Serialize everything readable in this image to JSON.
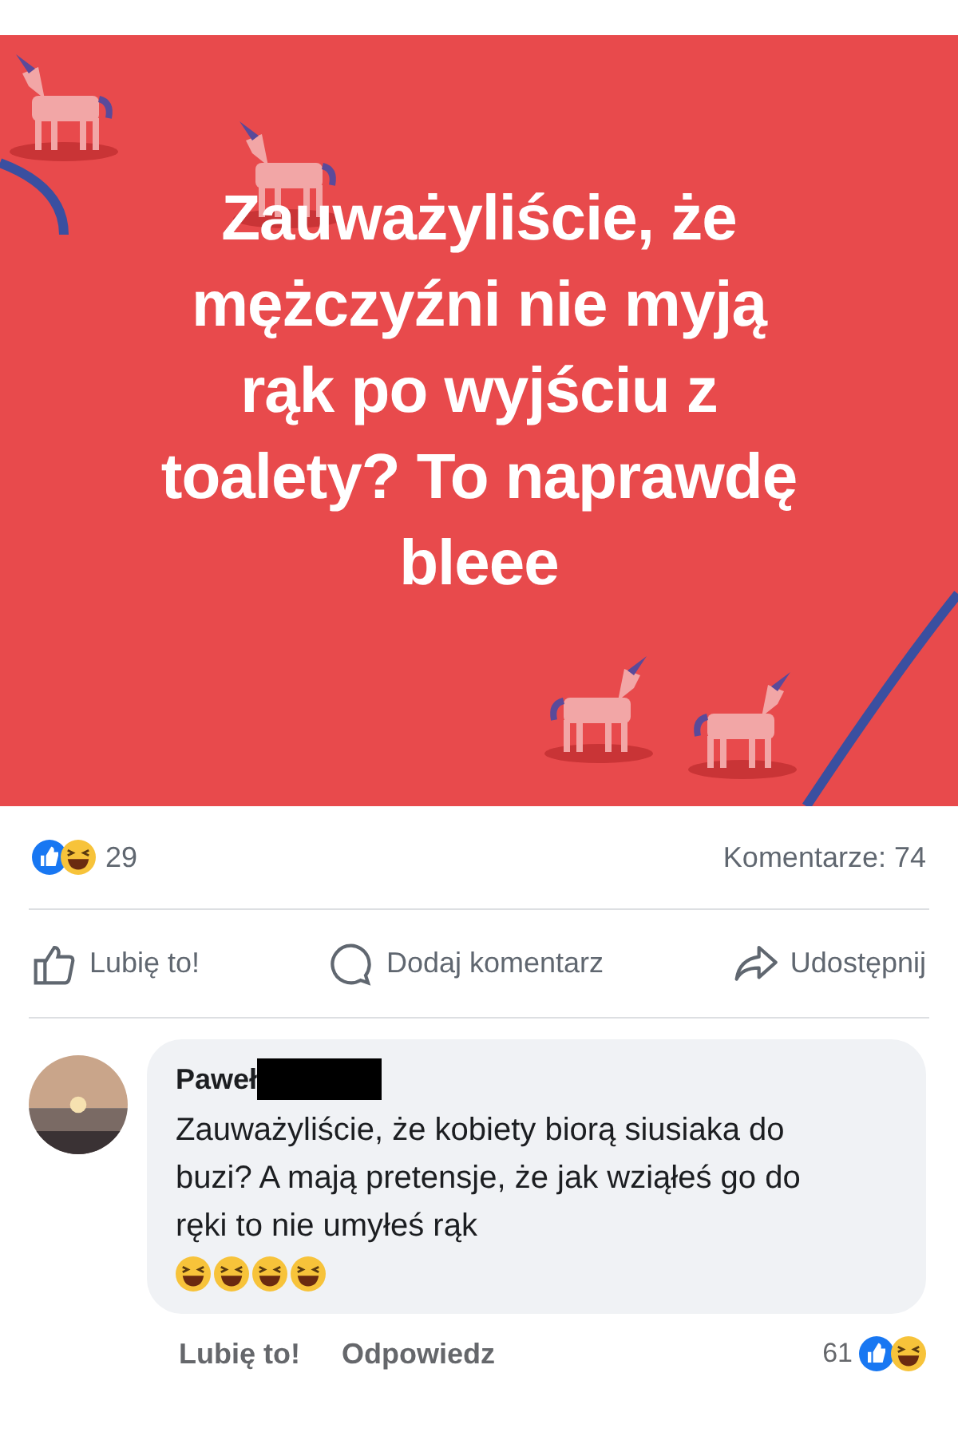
{
  "post": {
    "image_text_lines": [
      "Zauważyliście, że",
      "mężczyźni nie myją",
      "rąk po wyjściu z",
      "toalety? To naprawdę",
      "bleee"
    ],
    "reaction_count": "29",
    "comment_count": "Komentarze: 74",
    "actions": [
      {
        "kind": "like",
        "label": "Lubię to!"
      },
      {
        "kind": "comment",
        "label": "Dodaj komentarz"
      },
      {
        "kind": "share",
        "label": "Udostępnij"
      }
    ]
  },
  "comment": {
    "author": "Paweł",
    "author_redacted": true,
    "text": "Zauważyliście, że kobiety biorą siusiaka do buzi? A mają pretensje, że jak wziąłeś go do ręki to nie umyłeś rąk",
    "emojis": [
      {
        "kind": "laughing"
      },
      {
        "kind": "laughing"
      },
      {
        "kind": "laughing"
      },
      {
        "kind": "laughing"
      }
    ],
    "actions": [
      "Lubię to!",
      "Odpowiedz"
    ],
    "reaction_count": "61"
  }
}
